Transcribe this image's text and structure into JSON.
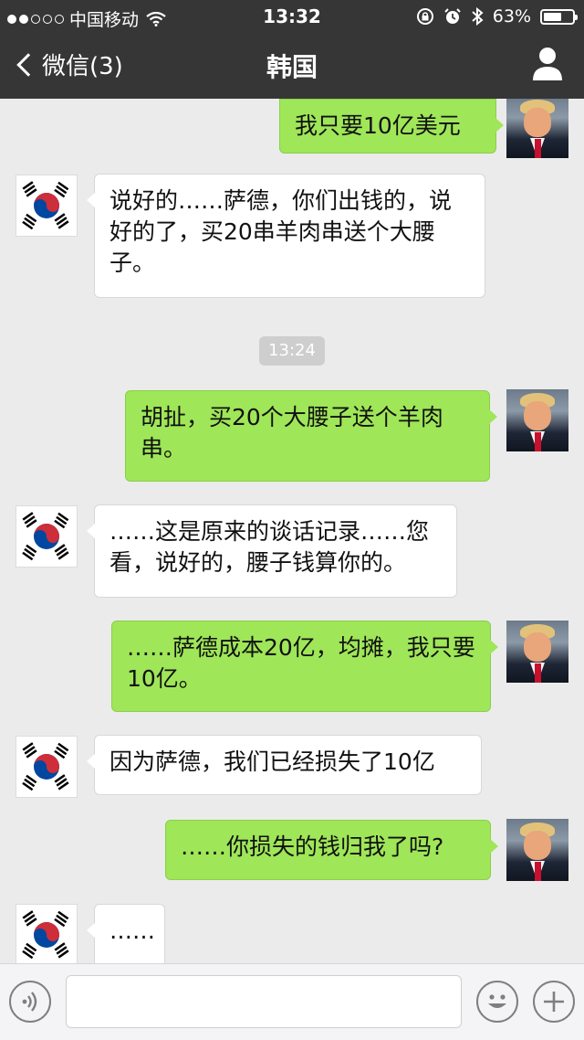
{
  "status_bar": {
    "carrier": "中国移动",
    "time": "13:32",
    "battery": "63%",
    "battery_level": 0.63,
    "icons": [
      "signal-dots-icon",
      "wifi-icon",
      "orientation-lock-icon",
      "alarm-icon",
      "bluetooth-icon",
      "battery-icon"
    ]
  },
  "nav": {
    "back_label": "微信(3)",
    "title": "韩国",
    "icons": [
      "chevron-left-icon",
      "person-icon"
    ]
  },
  "chat": {
    "messages": [
      {
        "side": "right",
        "text": "我只要10亿美元",
        "avatar": "trump-avatar"
      },
      {
        "side": "left",
        "text": "说好的……萨德，你们出钱的，说好的了，买20串羊肉串送个大腰子。",
        "avatar": "korea-flag-avatar"
      },
      {
        "side": "right",
        "text": "胡扯，买20个大腰子送个羊肉串。",
        "avatar": "trump-avatar"
      },
      {
        "side": "left",
        "text": "……这是原来的谈话记录……您看，说好的，腰子钱算你的。",
        "avatar": "korea-flag-avatar"
      },
      {
        "side": "right",
        "text": "……萨德成本20亿，均摊，我只要10亿。",
        "avatar": "trump-avatar"
      },
      {
        "side": "left",
        "text": "因为萨德，我们已经损失了10亿",
        "avatar": "korea-flag-avatar"
      },
      {
        "side": "right",
        "text": "……你损失的钱归我了吗?",
        "avatar": "trump-avatar"
      },
      {
        "side": "left",
        "text": "……",
        "avatar": "korea-flag-avatar"
      }
    ],
    "timestamp": "13:24"
  },
  "input_bar": {
    "icons": [
      "voice-icon",
      "emoji-icon",
      "plus-icon"
    ],
    "value": ""
  },
  "colors": {
    "nav_bg": "#363636",
    "chat_bg": "#ebebeb",
    "bubble_sent": "#9fe658",
    "bubble_received": "#ffffff"
  }
}
